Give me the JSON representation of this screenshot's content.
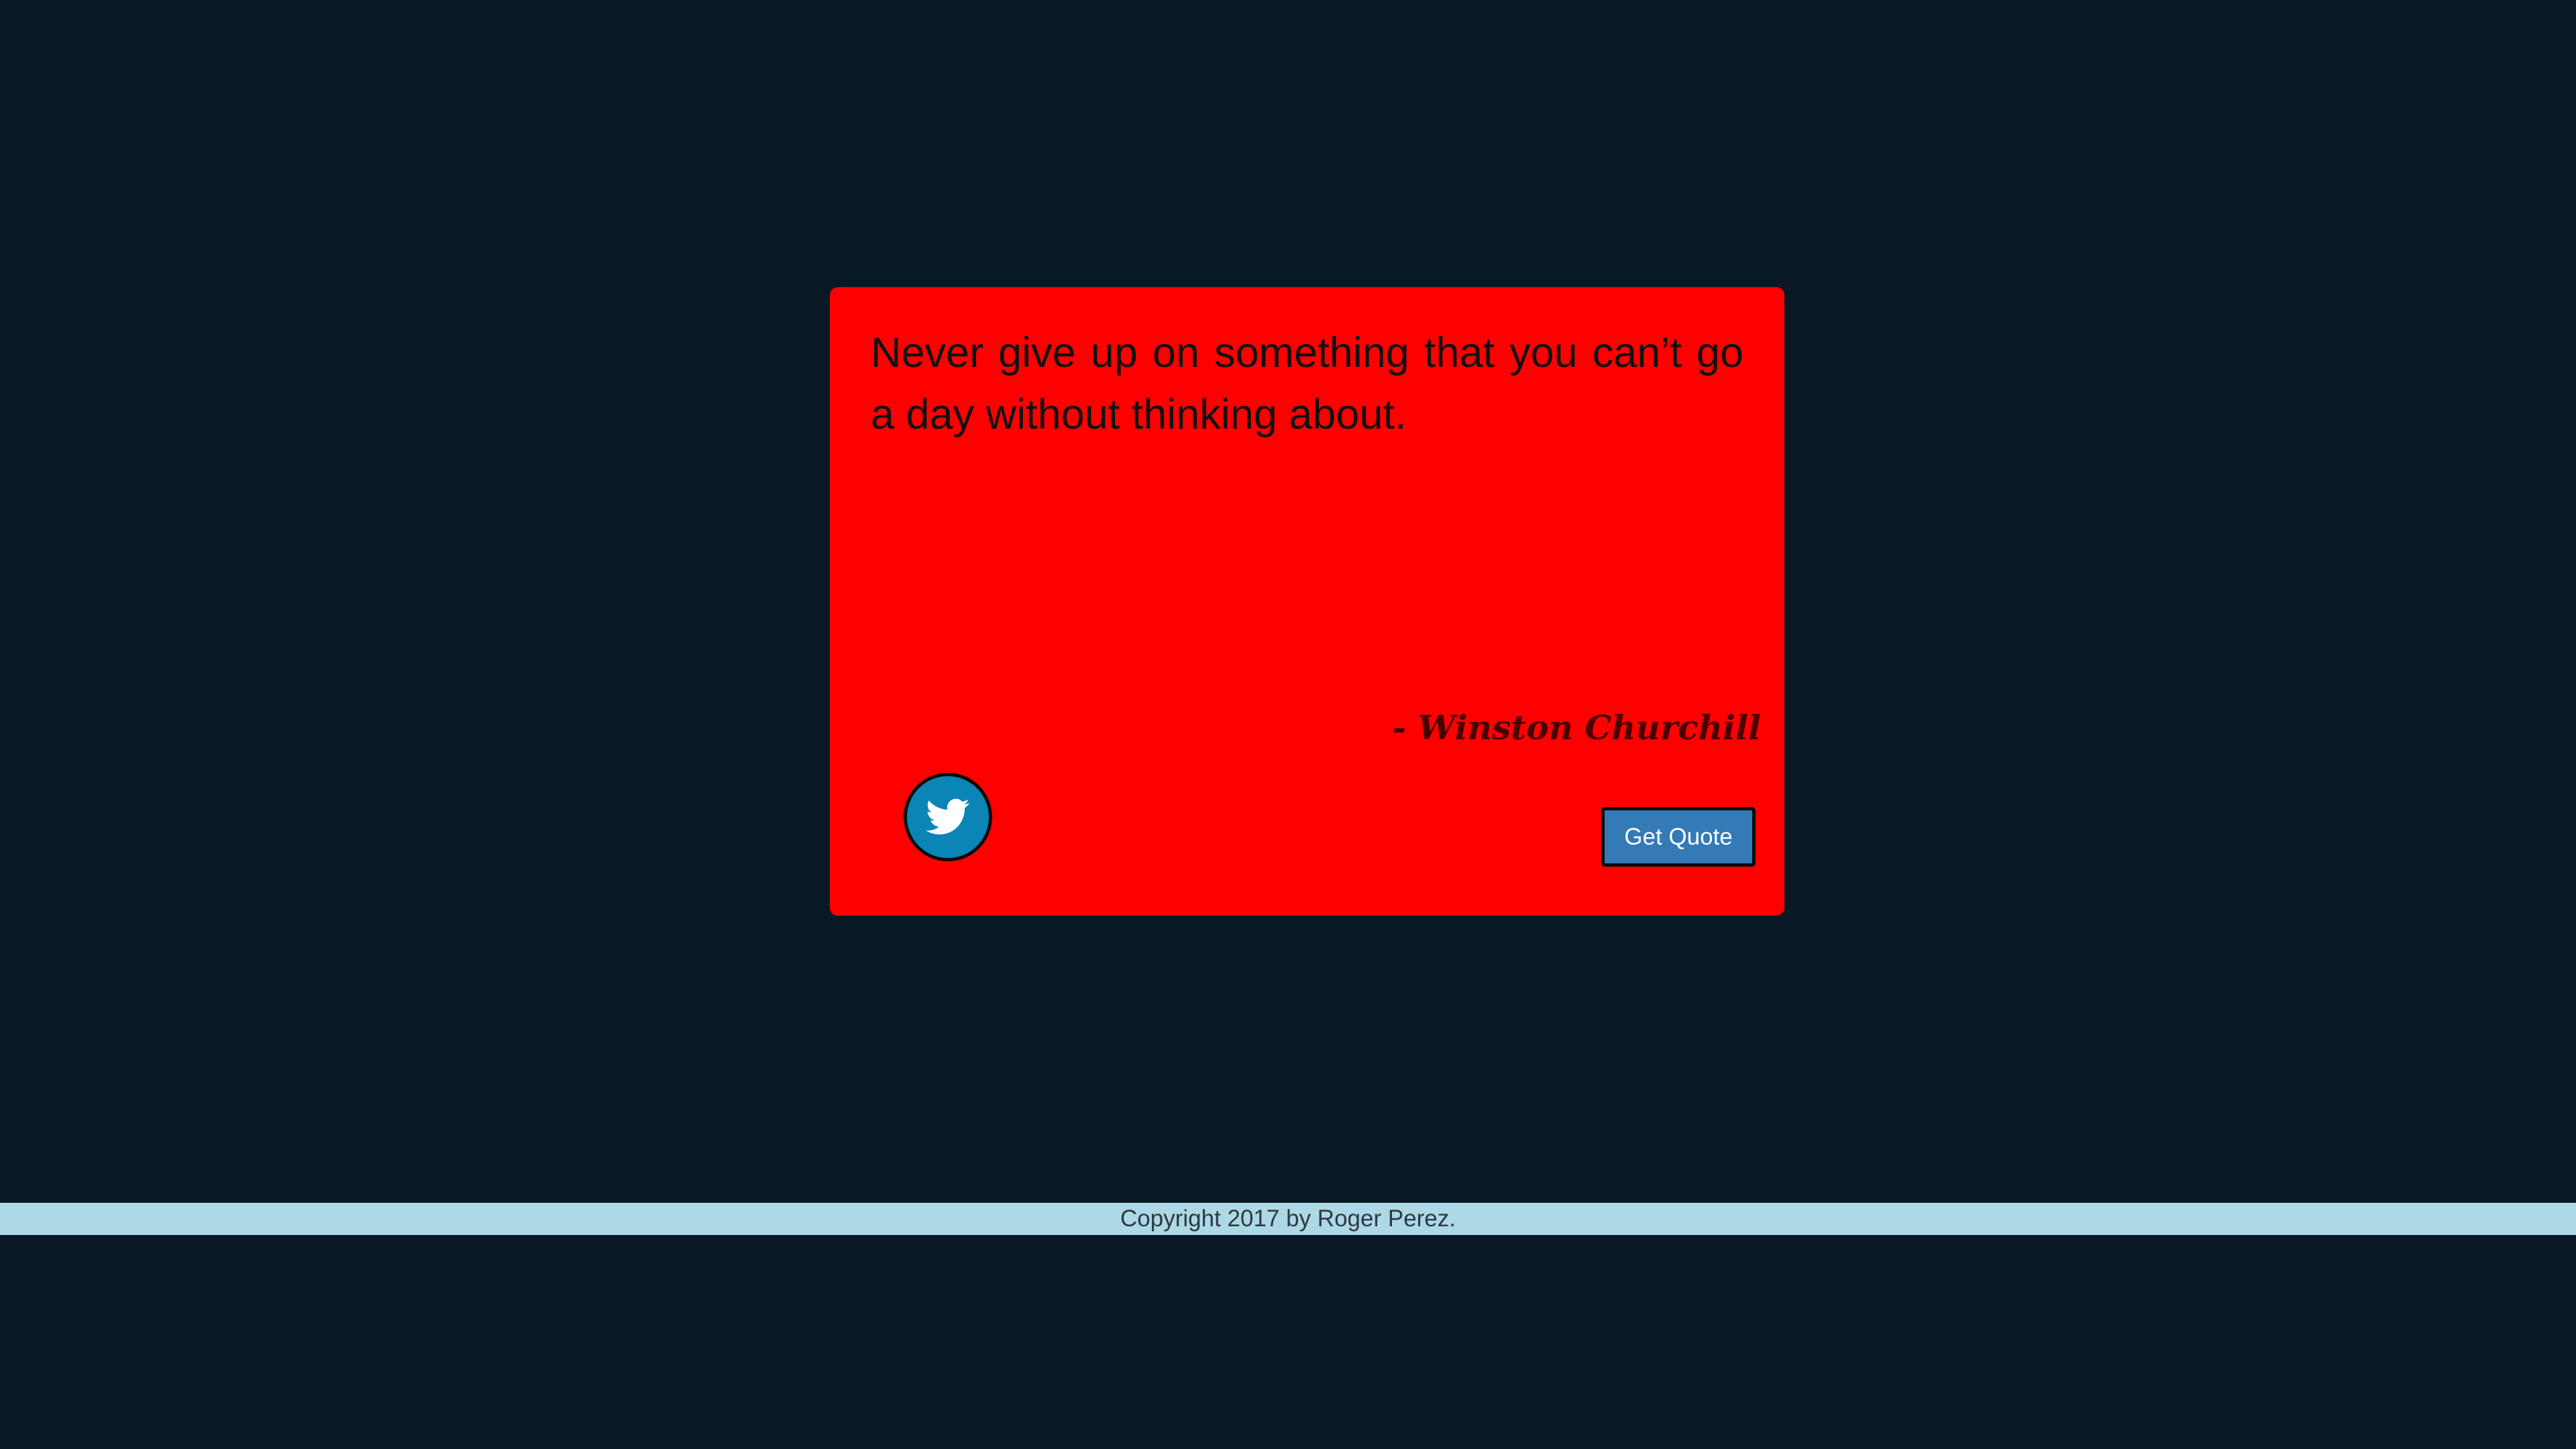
{
  "quote": {
    "text": "Never give up on something that you can’t go a day without thinking about.",
    "author": "- Winston Churchill"
  },
  "actions": {
    "tweet_icon": "twitter-bird-icon",
    "get_quote_label": "Get Quote"
  },
  "footer": {
    "copyright": "Copyright 2017 by Roger Perez."
  },
  "colors": {
    "background": "#081925",
    "card": "#ff0000",
    "tweet_button": "#0a85b5",
    "get_quote_button": "#337ab7",
    "footer_bar": "#add8e6"
  }
}
